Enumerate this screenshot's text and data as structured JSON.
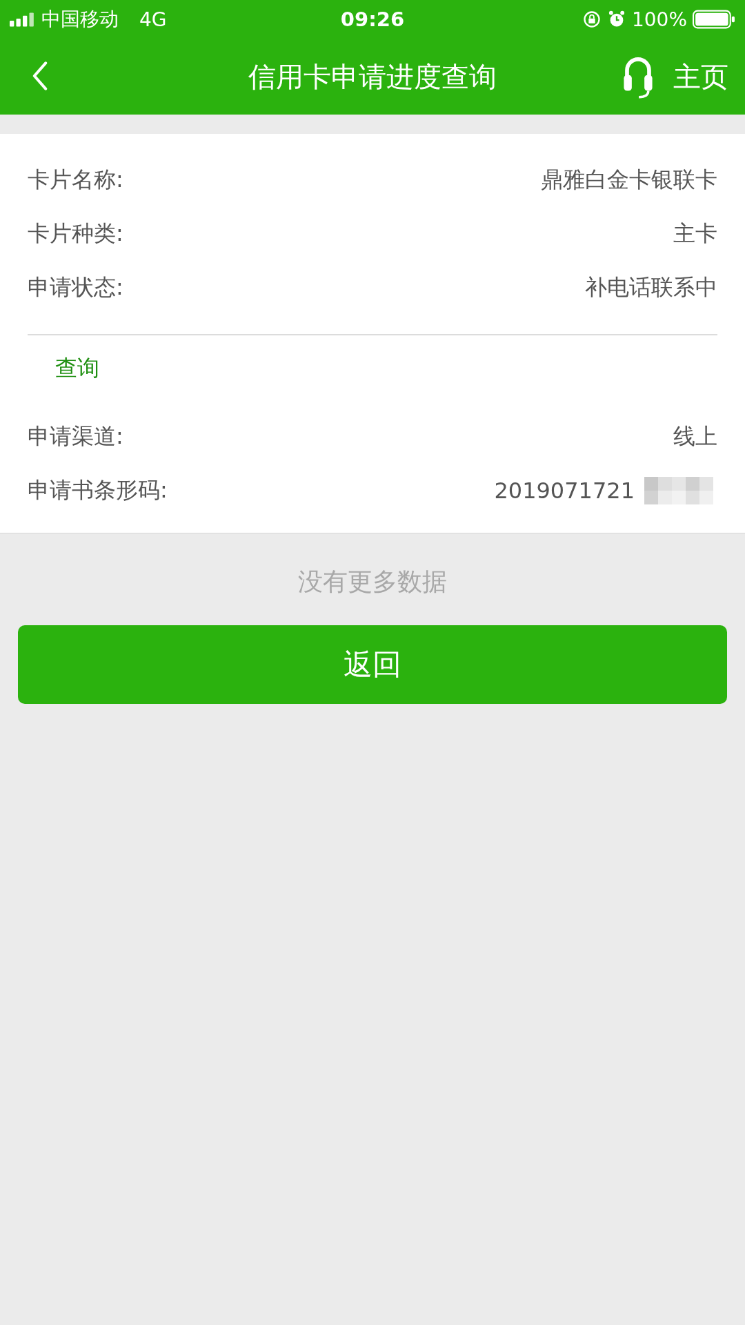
{
  "status_bar": {
    "carrier": "中国移动",
    "network": "4G",
    "time": "09:26",
    "battery": "100%"
  },
  "header": {
    "title": "信用卡申请进度查询",
    "home": "主页"
  },
  "card": {
    "rows": [
      {
        "label": "卡片名称:",
        "value": "鼎雅白金卡银联卡"
      },
      {
        "label": "卡片种类:",
        "value": "主卡"
      },
      {
        "label": "申请状态:",
        "value": "补电话联系中"
      }
    ],
    "section_link": "查询",
    "detail_rows": [
      {
        "label": "申请渠道:",
        "value": "线上",
        "masked": false
      },
      {
        "label": "申请书条形码:",
        "value": "2019071721",
        "masked": true
      }
    ]
  },
  "footer_note": "没有更多数据",
  "button": "返回"
}
